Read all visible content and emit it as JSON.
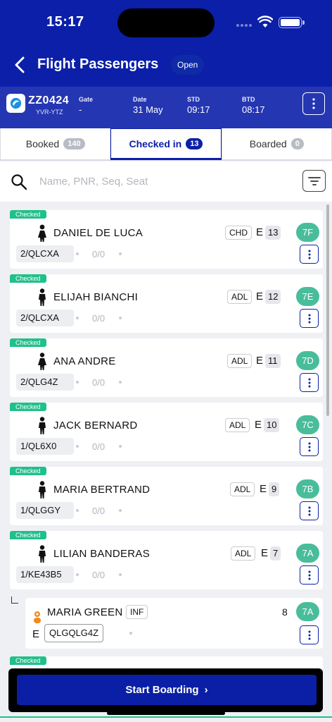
{
  "status_bar": {
    "time": "15:17"
  },
  "header": {
    "title": "Flight Passengers",
    "status_badge": "Open"
  },
  "flight": {
    "number": "ZZ0424",
    "route": "YVR-YTZ",
    "gate_label": "Gate",
    "gate_value": "-",
    "date_label": "Date",
    "date_value": "31 May",
    "std_label": "STD",
    "std_value": "09:17",
    "btd_label": "BTD",
    "btd_value": "08:17"
  },
  "tabs": [
    {
      "label": "Booked",
      "count": "140"
    },
    {
      "label": "Checked in",
      "count": "13"
    },
    {
      "label": "Boarded",
      "count": "0"
    }
  ],
  "search": {
    "placeholder": "Name, PNR, Seq, Seat"
  },
  "checked_label": "Checked",
  "passengers": [
    {
      "name": "DANIEL DE LUCA",
      "type": "CHD",
      "cabin": "E",
      "seq": "13",
      "seat": "7F",
      "pnr": "2/QLCXA",
      "bags": "0/0",
      "icon": "child-female-icon"
    },
    {
      "name": "ELIJAH BIANCHI",
      "type": "ADL",
      "cabin": "E",
      "seq": "12",
      "seat": "7E",
      "pnr": "2/QLCXA",
      "bags": "0/0",
      "icon": "male-person-icon"
    },
    {
      "name": "ANA ANDRE",
      "type": "ADL",
      "cabin": "E",
      "seq": "11",
      "seat": "7D",
      "pnr": "2/QLG4Z",
      "bags": "0/0",
      "icon": "female-person-icon"
    },
    {
      "name": "JACK BERNARD",
      "type": "ADL",
      "cabin": "E",
      "seq": "10",
      "seat": "7C",
      "pnr": "1/QL6X0",
      "bags": "0/0",
      "icon": "male-person-icon"
    },
    {
      "name": "MARIA BERTRAND",
      "type": "ADL",
      "cabin": "E",
      "seq": "9",
      "seat": "7B",
      "pnr": "1/QLGGY",
      "bags": "0/0",
      "icon": "male-person-icon"
    },
    {
      "name": "LILIAN BANDERAS",
      "type": "ADL",
      "cabin": "E",
      "seq": "7",
      "seat": "7A",
      "pnr": "1/KE43B5",
      "bags": "0/0",
      "icon": "male-person-icon"
    }
  ],
  "infant": {
    "name": "MARIA GREEN",
    "type": "INF",
    "cabin": "E",
    "seq": "8",
    "seat": "7A",
    "pnr": "QLGQLG4Z",
    "icon": "infant-icon"
  },
  "footer": {
    "start_label": "Start Boarding",
    "chevron": "›"
  },
  "colors": {
    "header": "#0b1fa8",
    "flight_bar": "#2536b2",
    "checked": "#20c08a",
    "seat": "#49bd9a"
  }
}
